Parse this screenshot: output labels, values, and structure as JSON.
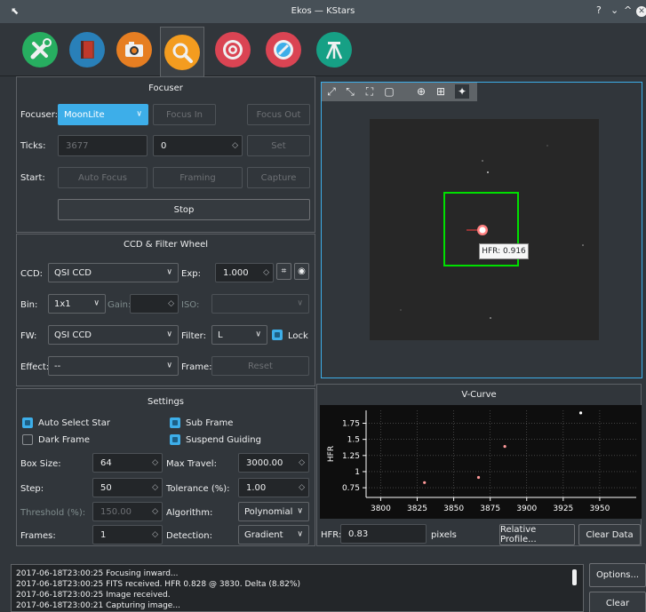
{
  "window": {
    "title": "Ekos — KStars",
    "help": "?",
    "minimize": "⌄",
    "maximize": "^",
    "close": "✕"
  },
  "focuser": {
    "title": "Focuser",
    "focuser_label": "Focuser:",
    "focuser_value": "MoonLite",
    "focus_in": "Focus In",
    "focus_out": "Focus Out",
    "ticks_label": "Ticks:",
    "ticks_value": "3677",
    "ticks_input": "0",
    "set": "Set",
    "start_label": "Start:",
    "auto_focus": "Auto Focus",
    "framing": "Framing",
    "capture": "Capture",
    "stop": "Stop"
  },
  "ccd": {
    "title": "CCD & Filter Wheel",
    "ccd_label": "CCD:",
    "ccd_value": "QSI CCD",
    "exp_label": "Exp:",
    "exp_value": "1.000",
    "bin_label": "Bin:",
    "bin_value": "1x1",
    "gain_label": "Gain:",
    "iso_label": "ISO:",
    "fw_label": "FW:",
    "fw_value": "QSI CCD",
    "filter_label": "Filter:",
    "filter_value": "L",
    "lock_label": "Lock",
    "effect_label": "Effect:",
    "effect_value": "--",
    "frame_label": "Frame:",
    "reset": "Reset"
  },
  "settings": {
    "title": "Settings",
    "auto_select_star": "Auto Select Star",
    "sub_frame": "Sub Frame",
    "dark_frame": "Dark Frame",
    "suspend_guiding": "Suspend Guiding",
    "box_size_label": "Box Size:",
    "box_size": "64",
    "max_travel_label": "Max Travel:",
    "max_travel": "3000.00",
    "step_label": "Step:",
    "step": "50",
    "tolerance_label": "Tolerance (%):",
    "tolerance": "1.00",
    "threshold_label": "Threshold (%):",
    "threshold": "150.00",
    "algorithm_label": "Algorithm:",
    "algorithm": "Polynomial",
    "frames_label": "Frames:",
    "frames": "1",
    "detection_label": "Detection:",
    "detection": "Gradient"
  },
  "viewer": {
    "hfr_tooltip": "HFR: 0.916"
  },
  "vcurve": {
    "title": "V-Curve",
    "hfr_label": "HFR:",
    "hfr_value": "0.83",
    "pixels": "pixels",
    "relative_profile": "Relative Profile...",
    "clear_data": "Clear Data"
  },
  "chart_data": {
    "type": "scatter",
    "title": "V-Curve",
    "xlabel": "",
    "ylabel": "HFR",
    "xlim": [
      3790,
      3975
    ],
    "ylim": [
      0.6,
      1.95
    ],
    "xticks": [
      "3800",
      "3825",
      "3850",
      "3875",
      "3900",
      "3925",
      "3950"
    ],
    "yticks": [
      "0.75",
      "1",
      "1.25",
      "1.5",
      "1.75"
    ],
    "grid": true,
    "series": [
      {
        "x": [
          3830,
          3867,
          3885,
          3937
        ],
        "y": [
          0.83,
          0.91,
          1.39,
          1.91
        ]
      }
    ]
  },
  "log": {
    "lines": [
      "2017-06-18T23:00:25 Focusing inward...",
      "2017-06-18T23:00:25 FITS received. HFR 0.828 @ 3830. Delta (8.82%)",
      "2017-06-18T23:00:25 Image received.",
      "2017-06-18T23:00:21 Capturing image..."
    ],
    "options": "Options...",
    "clear": "Clear"
  },
  "colors": {
    "accent": "#3daee9",
    "background": "#31363b",
    "focus_box": "#00e000"
  },
  "tabs": [
    "setup-icon",
    "scheduler-icon",
    "capture-icon",
    "focus-icon",
    "mount-icon",
    "align-icon",
    "guide-icon"
  ]
}
